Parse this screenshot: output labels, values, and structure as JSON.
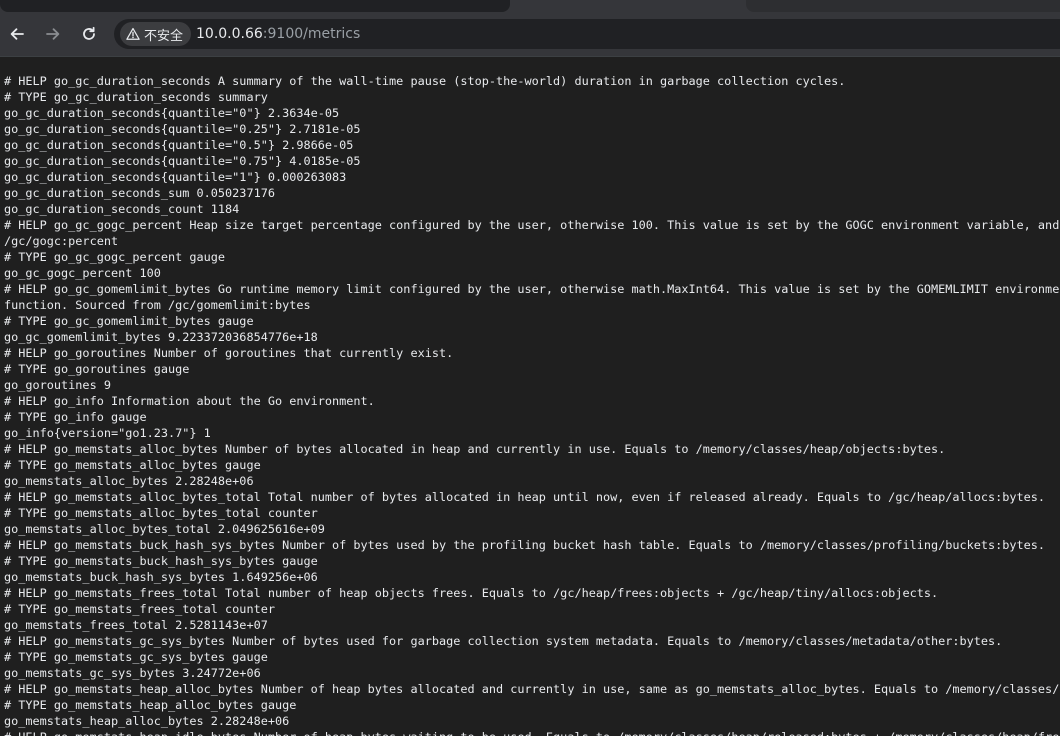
{
  "browser": {
    "security_label": "不安全",
    "url_host": "10.0.0.66",
    "url_rest": ":9100/metrics"
  },
  "metrics_lines": [
    "# HELP go_gc_duration_seconds A summary of the wall-time pause (stop-the-world) duration in garbage collection cycles.",
    "# TYPE go_gc_duration_seconds summary",
    "go_gc_duration_seconds{quantile=\"0\"} 2.3634e-05",
    "go_gc_duration_seconds{quantile=\"0.25\"} 2.7181e-05",
    "go_gc_duration_seconds{quantile=\"0.5\"} 2.9866e-05",
    "go_gc_duration_seconds{quantile=\"0.75\"} 4.0185e-05",
    "go_gc_duration_seconds{quantile=\"1\"} 0.000263083",
    "go_gc_duration_seconds_sum 0.050237176",
    "go_gc_duration_seconds_count 1184",
    "# HELP go_gc_gogc_percent Heap size target percentage configured by the user, otherwise 100. This value is set by the GOGC environment variable, and th",
    "/gc/gogc:percent",
    "# TYPE go_gc_gogc_percent gauge",
    "go_gc_gogc_percent 100",
    "# HELP go_gc_gomemlimit_bytes Go runtime memory limit configured by the user, otherwise math.MaxInt64. This value is set by the GOMEMLIMIT environment",
    "function. Sourced from /gc/gomemlimit:bytes",
    "# TYPE go_gc_gomemlimit_bytes gauge",
    "go_gc_gomemlimit_bytes 9.223372036854776e+18",
    "# HELP go_goroutines Number of goroutines that currently exist.",
    "# TYPE go_goroutines gauge",
    "go_goroutines 9",
    "# HELP go_info Information about the Go environment.",
    "# TYPE go_info gauge",
    "go_info{version=\"go1.23.7\"} 1",
    "# HELP go_memstats_alloc_bytes Number of bytes allocated in heap and currently in use. Equals to /memory/classes/heap/objects:bytes.",
    "# TYPE go_memstats_alloc_bytes gauge",
    "go_memstats_alloc_bytes 2.28248e+06",
    "# HELP go_memstats_alloc_bytes_total Total number of bytes allocated in heap until now, even if released already. Equals to /gc/heap/allocs:bytes.",
    "# TYPE go_memstats_alloc_bytes_total counter",
    "go_memstats_alloc_bytes_total 2.049625616e+09",
    "# HELP go_memstats_buck_hash_sys_bytes Number of bytes used by the profiling bucket hash table. Equals to /memory/classes/profiling/buckets:bytes.",
    "# TYPE go_memstats_buck_hash_sys_bytes gauge",
    "go_memstats_buck_hash_sys_bytes 1.649256e+06",
    "# HELP go_memstats_frees_total Total number of heap objects frees. Equals to /gc/heap/frees:objects + /gc/heap/tiny/allocs:objects.",
    "# TYPE go_memstats_frees_total counter",
    "go_memstats_frees_total 2.5281143e+07",
    "# HELP go_memstats_gc_sys_bytes Number of bytes used for garbage collection system metadata. Equals to /memory/classes/metadata/other:bytes.",
    "# TYPE go_memstats_gc_sys_bytes gauge",
    "go_memstats_gc_sys_bytes 3.24772e+06",
    "# HELP go_memstats_heap_alloc_bytes Number of heap bytes allocated and currently in use, same as go_memstats_alloc_bytes. Equals to /memory/classes/hea",
    "# TYPE go_memstats_heap_alloc_bytes gauge",
    "go_memstats_heap_alloc_bytes 2.28248e+06",
    "# HELP go_memstats_heap_idle_bytes Number of heap bytes waiting to be used. Equals to /memory/classes/heap/released:bytes + /memory/classes/heap/free:b"
  ]
}
